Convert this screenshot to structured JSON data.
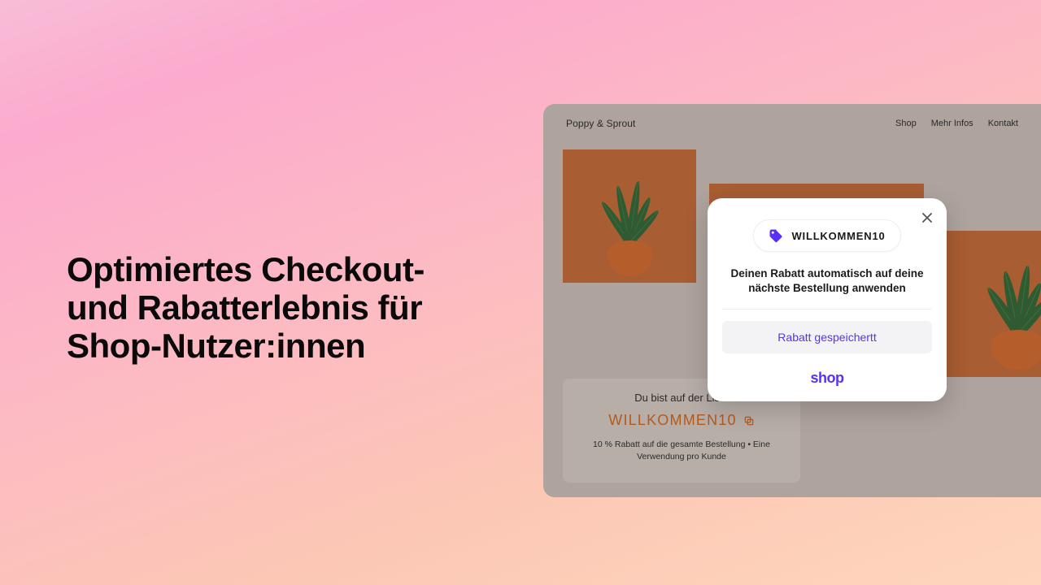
{
  "headline": "Optimiertes Checkout- und Rabatterlebnis für Shop-Nutzer:innen",
  "store": {
    "brand": "Poppy & Sprout",
    "nav": {
      "shop": "Shop",
      "more": "Mehr Infos",
      "contact": "Kontakt"
    }
  },
  "promo": {
    "title": "Du bist auf der Liste",
    "code": "WILLKOMMEN10",
    "terms": "10 % Rabatt auf die gesamte Bestellung • Eine Verwendung pro Kunde"
  },
  "modal": {
    "code": "WILLKOMMEN10",
    "body": "Deinen Rabatt automatisch auf deine nächste Bestellung anwenden",
    "button": "Rabatt gespeichertt",
    "logo": "shop"
  }
}
